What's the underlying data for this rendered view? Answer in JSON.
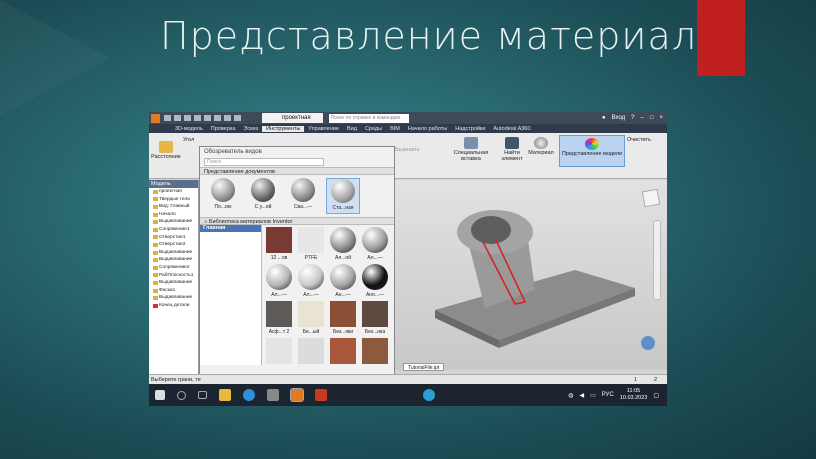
{
  "slide": {
    "title": "Представление материала"
  },
  "app": {
    "doc_tab": "проектная",
    "search_placeholder": "Поиск по справке и командам",
    "login": "Вход",
    "menu": [
      "3D-модель",
      "Проверка",
      "Эскиз",
      "Инструменты",
      "Управление",
      "Вид",
      "Среды",
      "BIM",
      "Начало работы",
      "Надстройки",
      "Autodesk A360"
    ],
    "menu_active": "Инструменты"
  },
  "ribbon": {
    "distance": "Расстояние",
    "angle": "Угол",
    "special_insert": "Специальная вставка",
    "find_element": "Найти элемент",
    "material": "Материал",
    "model_representation": "Представление модели",
    "clear": "Очистить",
    "cut_copy": "Вырезать"
  },
  "model_panel": {
    "header": "Модель",
    "tree": [
      "проектная",
      "Твердые тела",
      "Вид: Главный",
      "Начало",
      "Выдавливание",
      "Сопряжение1",
      "Отверстие1",
      "Отверстие2",
      "Выдавливание",
      "Выдавливание",
      "Сопряжение2",
      "РабПлоскость1",
      "Выдавливание",
      "Фаска1",
      "Выдавливание",
      "Конец детали"
    ]
  },
  "browser": {
    "title": "Обозреватель видов",
    "search_placeholder": "Поиск",
    "doc_section": "Представление документов",
    "doc_materials": [
      "По...ию",
      "С у...ой",
      "Сва...—",
      "Ста...ная"
    ],
    "doc_selected": 3,
    "lib_section": "Библиотека материалов Inventor",
    "lib_home": "Главная",
    "library": [
      {
        "label": "12 ...ов",
        "color": "#7a3a34"
      },
      {
        "label": "PTFE",
        "color": "#e6e6e6"
      },
      {
        "label": "Ал...ой",
        "color": "#8f8f8f"
      },
      {
        "label": "Ал...—",
        "color": "#9d9d9d"
      },
      {
        "label": "Ал...—",
        "color": "#b4b4b4"
      },
      {
        "label": "Ал...—",
        "color": "#c8c8c8"
      },
      {
        "label": "Ан...—",
        "color": "#a6a6a6"
      },
      {
        "label": "Ано...—",
        "color": "#111111"
      },
      {
        "label": "Асф...т 2",
        "color": "#5d5a58"
      },
      {
        "label": "Бе...ый",
        "color": "#e9e3d3"
      },
      {
        "label": "Без...яки",
        "color": "#8a5036"
      },
      {
        "label": "Без...нка",
        "color": "#5e4a40"
      },
      {
        "label": "",
        "color": "#e4e4e4"
      },
      {
        "label": "",
        "color": "#dcdcdc"
      },
      {
        "label": "",
        "color": "#a8573d"
      },
      {
        "label": "",
        "color": "#8c5a3c"
      }
    ]
  },
  "status": {
    "hint": "Выберите грани, те",
    "file_tab": "TutorialFile.ipt",
    "pages": [
      "1",
      "2"
    ]
  },
  "taskbar": {
    "lang": "РУС",
    "time": "11:05",
    "date": "10.03.2023"
  }
}
